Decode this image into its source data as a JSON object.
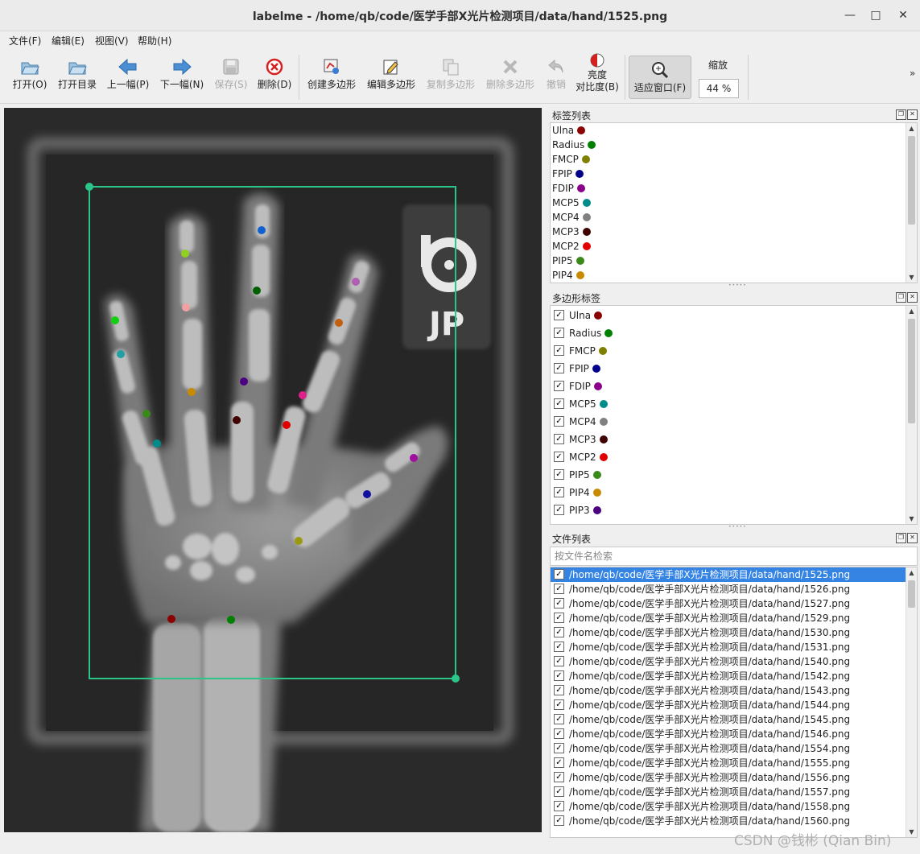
{
  "window": {
    "title": "labelme - /home/qb/code/医学手部X光片检测项目/data/hand/1525.png"
  },
  "menu": [
    "文件(F)",
    "编辑(E)",
    "视图(V)",
    "帮助(H)"
  ],
  "toolbar": {
    "open": "打开(O)",
    "open_dir": "打开目录",
    "prev": "上一幅(P)",
    "next": "下一幅(N)",
    "save": "保存(S)",
    "delete": "删除(D)",
    "create_polygon": "创建多边形",
    "edit_polygon": "编辑多边形",
    "copy_polygon": "复制多边形",
    "delete_polygon": "删除多边形",
    "undo": "撤销",
    "brightness_1": "亮度",
    "brightness_2": "对比度(B)",
    "fit_window": "适应窗口(F)",
    "zoom_label": "缩放",
    "zoom_value": "44 %",
    "more": "»"
  },
  "canvas": {
    "logo_text": "JP"
  },
  "label_list": {
    "title": "标签列表",
    "items": [
      {
        "name": "Ulna",
        "color": "#8b0000"
      },
      {
        "name": "Radius",
        "color": "#008000"
      },
      {
        "name": "FMCP",
        "color": "#808000"
      },
      {
        "name": "FPIP",
        "color": "#00008b"
      },
      {
        "name": "FDIP",
        "color": "#8b008b"
      },
      {
        "name": "MCP5",
        "color": "#008b8b"
      },
      {
        "name": "MCP4",
        "color": "#808080"
      },
      {
        "name": "MCP3",
        "color": "#400000"
      },
      {
        "name": "MCP2",
        "color": "#e00000"
      },
      {
        "name": "PIP5",
        "color": "#3a8a1a"
      },
      {
        "name": "PIP4",
        "color": "#c88a00"
      }
    ]
  },
  "polygon_labels": {
    "title": "多边形标签",
    "items": [
      {
        "name": "Ulna",
        "color": "#8b0000"
      },
      {
        "name": "Radius",
        "color": "#008000"
      },
      {
        "name": "FMCP",
        "color": "#808000"
      },
      {
        "name": "FPIP",
        "color": "#00008b"
      },
      {
        "name": "FDIP",
        "color": "#8b008b"
      },
      {
        "name": "MCP5",
        "color": "#008b8b"
      },
      {
        "name": "MCP4",
        "color": "#808080"
      },
      {
        "name": "MCP3",
        "color": "#400000"
      },
      {
        "name": "MCP2",
        "color": "#e00000"
      },
      {
        "name": "PIP5",
        "color": "#3a8a1a"
      },
      {
        "name": "PIP4",
        "color": "#c88a00"
      },
      {
        "name": "PIP3",
        "color": "#4b0082"
      }
    ]
  },
  "file_list": {
    "title": "文件列表",
    "search_placeholder": "按文件名检索",
    "files": [
      "/home/qb/code/医学手部X光片检测项目/data/hand/1525.png",
      "/home/qb/code/医学手部X光片检测项目/data/hand/1526.png",
      "/home/qb/code/医学手部X光片检测项目/data/hand/1527.png",
      "/home/qb/code/医学手部X光片检测项目/data/hand/1529.png",
      "/home/qb/code/医学手部X光片检测项目/data/hand/1530.png",
      "/home/qb/code/医学手部X光片检测项目/data/hand/1531.png",
      "/home/qb/code/医学手部X光片检测项目/data/hand/1540.png",
      "/home/qb/code/医学手部X光片检测项目/data/hand/1542.png",
      "/home/qb/code/医学手部X光片检测项目/data/hand/1543.png",
      "/home/qb/code/医学手部X光片检测项目/data/hand/1544.png",
      "/home/qb/code/医学手部X光片检测项目/data/hand/1545.png",
      "/home/qb/code/医学手部X光片检测项目/data/hand/1546.png",
      "/home/qb/code/医学手部X光片检测项目/data/hand/1554.png",
      "/home/qb/code/医学手部X光片检测项目/data/hand/1555.png",
      "/home/qb/code/医学手部X光片检测项目/data/hand/1556.png",
      "/home/qb/code/医学手部X光片检测项目/data/hand/1557.png",
      "/home/qb/code/医学手部X光片检测项目/data/hand/1558.png",
      "/home/qb/code/医学手部X光片检测项目/data/hand/1560.png"
    ]
  },
  "watermark": "CSDN @钱彬 (Qian Bin)"
}
